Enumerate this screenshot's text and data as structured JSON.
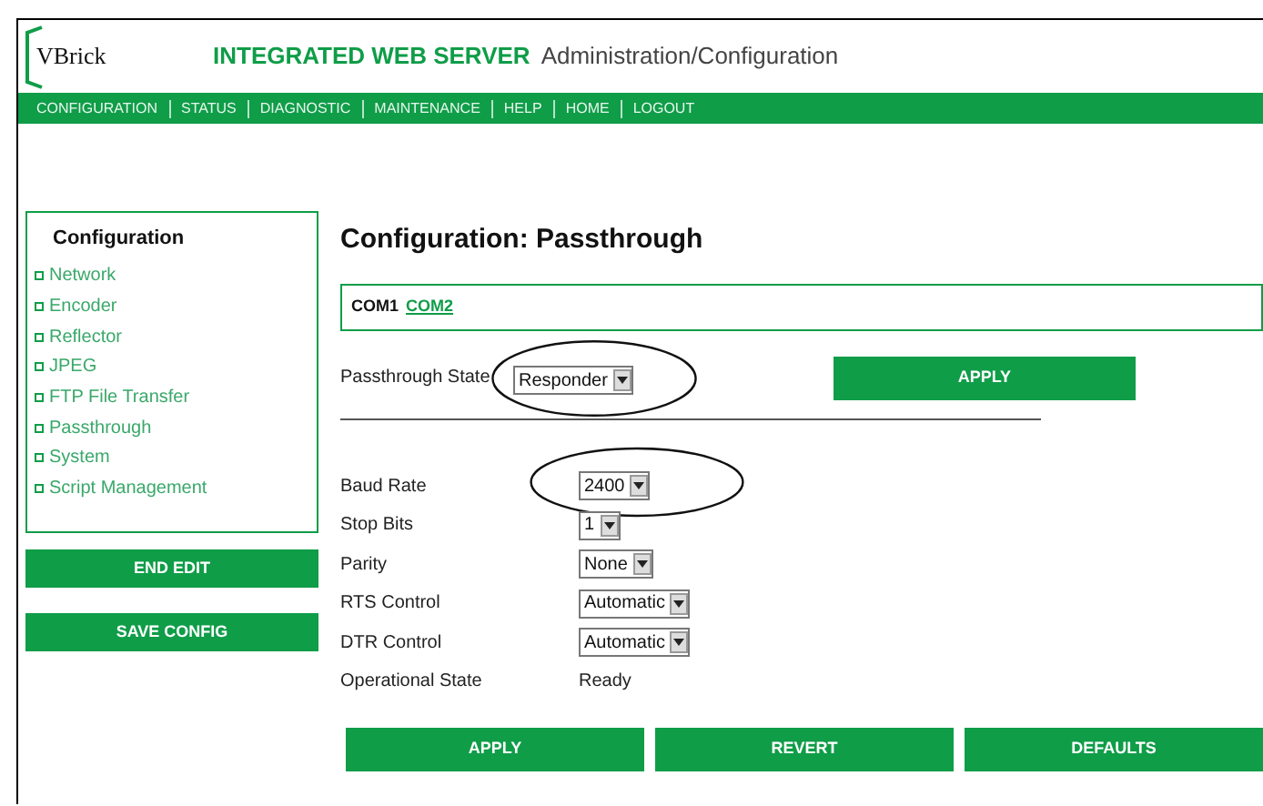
{
  "header": {
    "logo": "VBrick",
    "title": "INTEGRATED WEB SERVER",
    "subtitle": "Administration/Configuration"
  },
  "nav": [
    "CONFIGURATION",
    "STATUS",
    "DIAGNOSTIC",
    "MAINTENANCE",
    "HELP",
    "HOME",
    "LOGOUT"
  ],
  "sidebar": {
    "title": "Configuration",
    "items": [
      "Network",
      "Encoder",
      "Reflector",
      "JPEG",
      "FTP File Transfer",
      "Passthrough",
      "System",
      "Script Management"
    ],
    "buttons": [
      "END EDIT",
      "SAVE CONFIG"
    ]
  },
  "page_title": "Configuration: Passthrough",
  "ports": [
    {
      "label": "COM1",
      "selected": true
    },
    {
      "label": "COM2",
      "selected": false
    }
  ],
  "passthrough_state": {
    "label": "Passthrough State",
    "value": "Responder",
    "button": "APPLY",
    "circled": true
  },
  "fields": [
    {
      "label": "Baud Rate",
      "kind": "select",
      "value": "2400",
      "circled": true
    },
    {
      "label": "Stop Bits",
      "kind": "select",
      "value": "1",
      "circled": false
    },
    {
      "label": "Parity",
      "kind": "select",
      "value": "None",
      "circled": false
    },
    {
      "label": "RTS Control",
      "kind": "select",
      "value": "Automatic",
      "circled": false
    },
    {
      "label": "DTR Control",
      "kind": "select",
      "value": "Automatic",
      "circled": false
    },
    {
      "label": "Operational State",
      "kind": "text",
      "value": "Ready",
      "circled": false
    }
  ],
  "buttons": [
    "APPLY",
    "REVERT",
    "DEFAULTS"
  ]
}
